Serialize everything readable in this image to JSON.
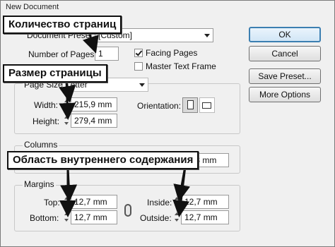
{
  "window": {
    "title": "New Document"
  },
  "document_preset": {
    "label": "Document Preset:",
    "value": "[Custom]"
  },
  "number_of_pages": {
    "label": "Number of Pages:",
    "value": "1"
  },
  "facing_pages": {
    "label": "Facing Pages",
    "checked": true
  },
  "master_text_frame": {
    "label": "Master Text Frame",
    "checked": false
  },
  "page_size": {
    "label": "Page Size:",
    "value": "Letter",
    "width_label": "Width:",
    "width_value": "215,9 mm",
    "height_label": "Height:",
    "height_value": "279,4 mm",
    "orientation_label": "Orientation:"
  },
  "columns": {
    "label": "Columns",
    "gutter_value": "4,233 mm"
  },
  "margins": {
    "label": "Margins",
    "top_label": "Top:",
    "top_value": "12,7 mm",
    "bottom_label": "Bottom:",
    "bottom_value": "12,7 mm",
    "inside_label": "Inside:",
    "inside_value": "12,7 mm",
    "outside_label": "Outside:",
    "outside_value": "12,7 mm"
  },
  "buttons": {
    "ok": "OK",
    "cancel": "Cancel",
    "save_preset": "Save Preset...",
    "more_options": "More Options"
  },
  "callouts": {
    "pages": "Количество страниц",
    "size": "Размер страницы",
    "content_area": "Область внутреннего содержания"
  },
  "colors": {
    "callout_border": "#111111",
    "arrow": "#111111",
    "default_button_border": "#3c7fb1"
  }
}
